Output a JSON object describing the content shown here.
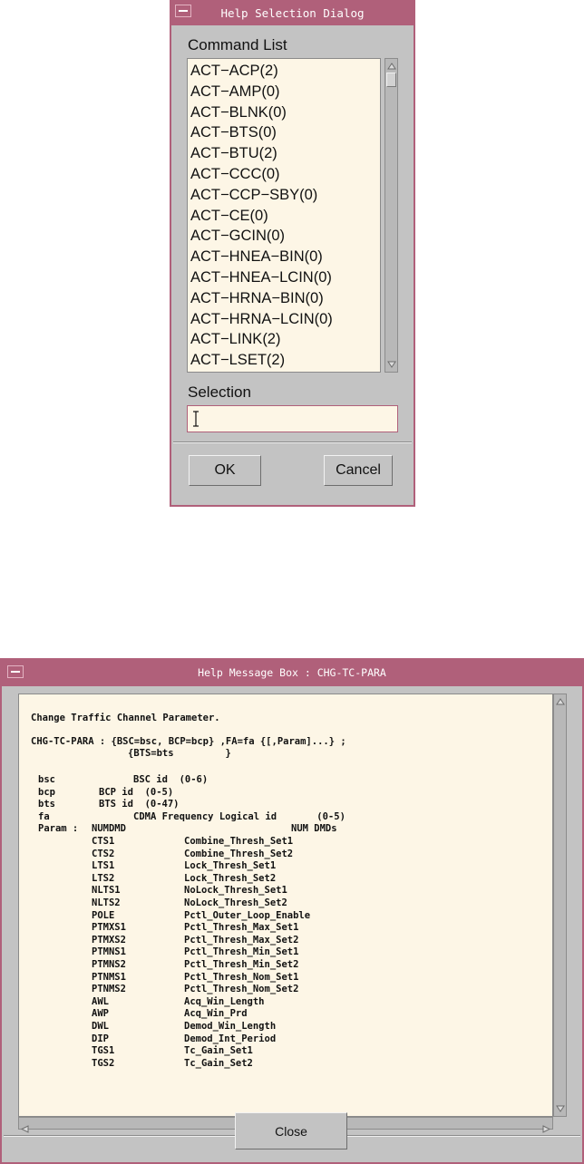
{
  "selection_dialog": {
    "title": "Help Selection Dialog",
    "command_list_label": "Command List",
    "items": [
      "ACT−ACP(2)",
      "ACT−AMP(0)",
      "ACT−BLNK(0)",
      "ACT−BTS(0)",
      "ACT−BTU(2)",
      "ACT−CCC(0)",
      "ACT−CCP−SBY(0)",
      "ACT−CE(0)",
      "ACT−GCIN(0)",
      "ACT−HNEA−BIN(0)",
      "ACT−HNEA−LCIN(0)",
      "ACT−HRNA−BIN(0)",
      "ACT−HRNA−LCIN(0)",
      "ACT−LINK(2)",
      "ACT−LSET(2)"
    ],
    "selection_label": "Selection",
    "selection_value": "",
    "ok_label": "OK",
    "cancel_label": "Cancel"
  },
  "message_box": {
    "title": "Help Message Box : CHG-TC-PARA",
    "description": "Change Traffic Channel Parameter.",
    "syntax_line1": "CHG-TC-PARA : {BSC=bsc, BCP=bcp} ,FA=fa {[,Param]...} ;",
    "syntax_line2": "{BTS=bts         }",
    "args": [
      {
        "name": "bsc",
        "desc": "BSC id  (0-6)"
      },
      {
        "name": "bcp",
        "desc": "BCP id  (0-5)"
      },
      {
        "name": "bts",
        "desc": "BTS id  (0-47)"
      },
      {
        "name": "fa",
        "desc": "CDMA Frequency Logical id       (0-5)"
      }
    ],
    "param_label": "Param :",
    "params": [
      {
        "code": "NUMDMD",
        "desc": "NUM DMDs"
      },
      {
        "code": "CTS1",
        "desc": "Combine_Thresh_Set1"
      },
      {
        "code": "CTS2",
        "desc": "Combine_Thresh_Set2"
      },
      {
        "code": "LTS1",
        "desc": "Lock_Thresh_Set1"
      },
      {
        "code": "LTS2",
        "desc": "Lock_Thresh_Set2"
      },
      {
        "code": "NLTS1",
        "desc": "NoLock_Thresh_Set1"
      },
      {
        "code": "NLTS2",
        "desc": "NoLock_Thresh_Set2"
      },
      {
        "code": "POLE",
        "desc": "Pctl_Outer_Loop_Enable"
      },
      {
        "code": "PTMXS1",
        "desc": "Pctl_Thresh_Max_Set1"
      },
      {
        "code": "PTMXS2",
        "desc": "Pctl_Thresh_Max_Set2"
      },
      {
        "code": "PTMNS1",
        "desc": "Pctl_Thresh_Min_Set1"
      },
      {
        "code": "PTMNS2",
        "desc": "Pctl_Thresh_Min_Set2"
      },
      {
        "code": "PTNMS1",
        "desc": "Pctl_Thresh_Nom_Set1"
      },
      {
        "code": "PTNMS2",
        "desc": "Pctl_Thresh_Nom_Set2"
      },
      {
        "code": "AWL",
        "desc": "Acq_Win_Length"
      },
      {
        "code": "AWP",
        "desc": "Acq_Win_Prd"
      },
      {
        "code": "DWL",
        "desc": "Demod_Win_Length"
      },
      {
        "code": "DIP",
        "desc": "Demod_Int_Period"
      },
      {
        "code": "TGS1",
        "desc": "Tc_Gain_Set1"
      },
      {
        "code": "TGS2",
        "desc": "Tc_Gain_Set2"
      }
    ],
    "close_label": "Close"
  },
  "icons": {
    "window_menu": "window-menu-icon",
    "scroll_up": "scroll-up-arrow-icon",
    "scroll_down": "scroll-down-arrow-icon",
    "scroll_left": "scroll-left-arrow-icon",
    "scroll_right": "scroll-right-arrow-icon",
    "text_cursor": "text-cursor-icon"
  },
  "colors": {
    "title_bar": "#b0607a",
    "window_bg": "#c3c3c3",
    "field_bg": "#fdf6e6"
  }
}
